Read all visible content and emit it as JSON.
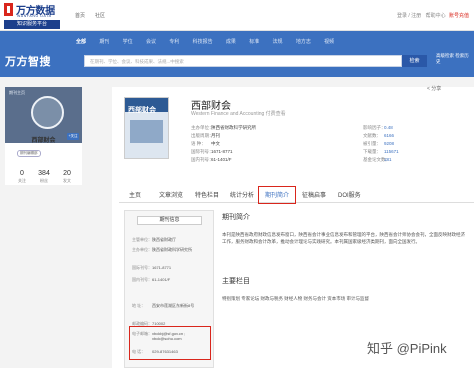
{
  "colors": {
    "brand_blue": "#3c71c0",
    "accent_red": "#d9261c"
  },
  "logo": {
    "name": "万方数据",
    "english": "WANFANG DATA",
    "subtitle": "知识服务平台"
  },
  "topnav": {
    "items": [
      "首页",
      "社区"
    ]
  },
  "topright": {
    "login": "登录 / 注册",
    "help": "帮助中心",
    "pay": "账号充值"
  },
  "brand": "万方智搜",
  "categories": [
    "全部",
    "期刊",
    "学位",
    "会议",
    "专利",
    "科技报告",
    "成果",
    "标准",
    "法规",
    "地方志",
    "视频"
  ],
  "search": {
    "placeholder": "在期刊、学位、会议、科技成果、法规...中搜索",
    "button": "检索",
    "advanced": "高级检索 检索历史"
  },
  "share": "< 分享",
  "card": {
    "home": "期刊主页",
    "name": "西部财会",
    "follow": "+关注",
    "tag": "期刊编辑部",
    "stats": [
      {
        "value": "0",
        "label": "关注"
      },
      {
        "value": "384",
        "label": "粉丝"
      },
      {
        "value": "20",
        "label": "发文"
      }
    ]
  },
  "cover": {
    "title": "西部财会"
  },
  "journal": {
    "title": "西部财会",
    "english": "Western Finance and Accounting 付费查看",
    "facts": [
      {
        "label": "主办单位：",
        "value": "陕西省财政科学研究所"
      },
      {
        "label": "出版周期：",
        "value": "月刊"
      },
      {
        "label": "语 种：",
        "value": "中文"
      },
      {
        "label": "国际刊号：",
        "value": "1671-8771"
      },
      {
        "label": "国内刊号：",
        "value": "61-1401/F"
      }
    ],
    "metrics": [
      {
        "label": "影响因子：",
        "value": "0.48"
      },
      {
        "label": "文献数：",
        "value": "6166"
      },
      {
        "label": "被引量：",
        "value": "9208"
      },
      {
        "label": "下载量：",
        "value": "115671"
      },
      {
        "label": "基金论文数：",
        "value": "181"
      }
    ]
  },
  "tabs": [
    "主页",
    "文章浏览",
    "特色栏目",
    "统计分析",
    "期刊简介",
    "征稿启事",
    "DOI服务"
  ],
  "side": {
    "title": "期刊信息",
    "rows": [
      {
        "label": "主管单位：",
        "value": "陕西省财政厅"
      },
      {
        "label": "主办单位：",
        "value": "陕西省财政科学研究所"
      },
      {
        "label": "国际刊号：",
        "value": "1671-8771"
      },
      {
        "label": "国内刊号：",
        "value": "61-1401/F"
      },
      {
        "label": "地 址：",
        "value": "西安市莲湖区东新街8号"
      },
      {
        "label": "邮政编码：",
        "value": "710002"
      },
      {
        "label": "电子邮箱：",
        "value": "xbckbj@sf.gov.cn ; xbck@sohu.com"
      },
      {
        "label": "电 话：",
        "value": "029-87631463"
      }
    ]
  },
  "intro": {
    "heading": "期刊简介",
    "text": "本刊是陕西省政府财政信息发布窗口，陕西省会计事业信息发布和管理的平台，陕西省会计师协会会刊，全面反映财政经济工作，服务财政和会计改革，推动会计理论与实践研究。本刊属国家级经济类期刊，面向全国发行。",
    "columns_heading": "主要栏目",
    "columns": "特别策划 专家论坛 财政与税务 财经人物 财务与会计 资本市场 审计与监督"
  },
  "watermark": "知乎 @PiPink"
}
